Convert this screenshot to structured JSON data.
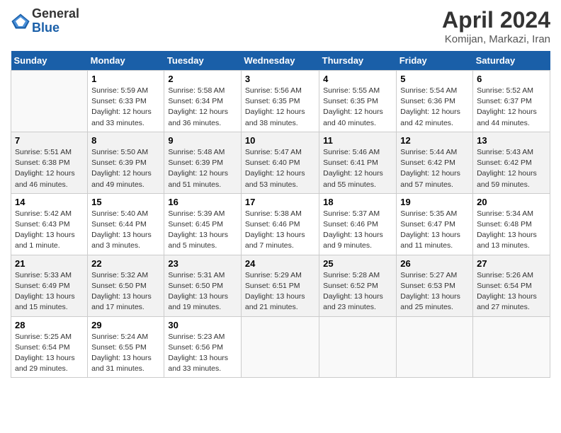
{
  "logo": {
    "general": "General",
    "blue": "Blue"
  },
  "title": "April 2024",
  "subtitle": "Komijan, Markazi, Iran",
  "days_of_week": [
    "Sunday",
    "Monday",
    "Tuesday",
    "Wednesday",
    "Thursday",
    "Friday",
    "Saturday"
  ],
  "weeks": [
    [
      {
        "day": "",
        "info": ""
      },
      {
        "day": "1",
        "info": "Sunrise: 5:59 AM\nSunset: 6:33 PM\nDaylight: 12 hours\nand 33 minutes."
      },
      {
        "day": "2",
        "info": "Sunrise: 5:58 AM\nSunset: 6:34 PM\nDaylight: 12 hours\nand 36 minutes."
      },
      {
        "day": "3",
        "info": "Sunrise: 5:56 AM\nSunset: 6:35 PM\nDaylight: 12 hours\nand 38 minutes."
      },
      {
        "day": "4",
        "info": "Sunrise: 5:55 AM\nSunset: 6:35 PM\nDaylight: 12 hours\nand 40 minutes."
      },
      {
        "day": "5",
        "info": "Sunrise: 5:54 AM\nSunset: 6:36 PM\nDaylight: 12 hours\nand 42 minutes."
      },
      {
        "day": "6",
        "info": "Sunrise: 5:52 AM\nSunset: 6:37 PM\nDaylight: 12 hours\nand 44 minutes."
      }
    ],
    [
      {
        "day": "7",
        "info": "Sunrise: 5:51 AM\nSunset: 6:38 PM\nDaylight: 12 hours\nand 46 minutes."
      },
      {
        "day": "8",
        "info": "Sunrise: 5:50 AM\nSunset: 6:39 PM\nDaylight: 12 hours\nand 49 minutes."
      },
      {
        "day": "9",
        "info": "Sunrise: 5:48 AM\nSunset: 6:39 PM\nDaylight: 12 hours\nand 51 minutes."
      },
      {
        "day": "10",
        "info": "Sunrise: 5:47 AM\nSunset: 6:40 PM\nDaylight: 12 hours\nand 53 minutes."
      },
      {
        "day": "11",
        "info": "Sunrise: 5:46 AM\nSunset: 6:41 PM\nDaylight: 12 hours\nand 55 minutes."
      },
      {
        "day": "12",
        "info": "Sunrise: 5:44 AM\nSunset: 6:42 PM\nDaylight: 12 hours\nand 57 minutes."
      },
      {
        "day": "13",
        "info": "Sunrise: 5:43 AM\nSunset: 6:42 PM\nDaylight: 12 hours\nand 59 minutes."
      }
    ],
    [
      {
        "day": "14",
        "info": "Sunrise: 5:42 AM\nSunset: 6:43 PM\nDaylight: 13 hours\nand 1 minute."
      },
      {
        "day": "15",
        "info": "Sunrise: 5:40 AM\nSunset: 6:44 PM\nDaylight: 13 hours\nand 3 minutes."
      },
      {
        "day": "16",
        "info": "Sunrise: 5:39 AM\nSunset: 6:45 PM\nDaylight: 13 hours\nand 5 minutes."
      },
      {
        "day": "17",
        "info": "Sunrise: 5:38 AM\nSunset: 6:46 PM\nDaylight: 13 hours\nand 7 minutes."
      },
      {
        "day": "18",
        "info": "Sunrise: 5:37 AM\nSunset: 6:46 PM\nDaylight: 13 hours\nand 9 minutes."
      },
      {
        "day": "19",
        "info": "Sunrise: 5:35 AM\nSunset: 6:47 PM\nDaylight: 13 hours\nand 11 minutes."
      },
      {
        "day": "20",
        "info": "Sunrise: 5:34 AM\nSunset: 6:48 PM\nDaylight: 13 hours\nand 13 minutes."
      }
    ],
    [
      {
        "day": "21",
        "info": "Sunrise: 5:33 AM\nSunset: 6:49 PM\nDaylight: 13 hours\nand 15 minutes."
      },
      {
        "day": "22",
        "info": "Sunrise: 5:32 AM\nSunset: 6:50 PM\nDaylight: 13 hours\nand 17 minutes."
      },
      {
        "day": "23",
        "info": "Sunrise: 5:31 AM\nSunset: 6:50 PM\nDaylight: 13 hours\nand 19 minutes."
      },
      {
        "day": "24",
        "info": "Sunrise: 5:29 AM\nSunset: 6:51 PM\nDaylight: 13 hours\nand 21 minutes."
      },
      {
        "day": "25",
        "info": "Sunrise: 5:28 AM\nSunset: 6:52 PM\nDaylight: 13 hours\nand 23 minutes."
      },
      {
        "day": "26",
        "info": "Sunrise: 5:27 AM\nSunset: 6:53 PM\nDaylight: 13 hours\nand 25 minutes."
      },
      {
        "day": "27",
        "info": "Sunrise: 5:26 AM\nSunset: 6:54 PM\nDaylight: 13 hours\nand 27 minutes."
      }
    ],
    [
      {
        "day": "28",
        "info": "Sunrise: 5:25 AM\nSunset: 6:54 PM\nDaylight: 13 hours\nand 29 minutes."
      },
      {
        "day": "29",
        "info": "Sunrise: 5:24 AM\nSunset: 6:55 PM\nDaylight: 13 hours\nand 31 minutes."
      },
      {
        "day": "30",
        "info": "Sunrise: 5:23 AM\nSunset: 6:56 PM\nDaylight: 13 hours\nand 33 minutes."
      },
      {
        "day": "",
        "info": ""
      },
      {
        "day": "",
        "info": ""
      },
      {
        "day": "",
        "info": ""
      },
      {
        "day": "",
        "info": ""
      }
    ]
  ]
}
